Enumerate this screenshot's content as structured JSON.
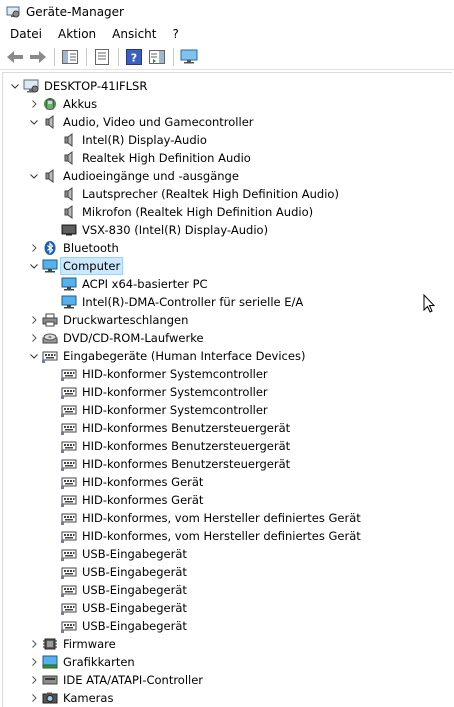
{
  "window": {
    "title": "Geräte-Manager",
    "icon": "device-manager-icon"
  },
  "menu": [
    {
      "id": "datei",
      "label": "Datei"
    },
    {
      "id": "aktion",
      "label": "Aktion"
    },
    {
      "id": "ansicht",
      "label": "Ansicht"
    },
    {
      "id": "help",
      "label": "?"
    }
  ],
  "toolbar": [
    {
      "id": "back",
      "icon": "arrow-left-icon"
    },
    {
      "id": "forward",
      "icon": "arrow-right-icon"
    },
    {
      "id": "sep1",
      "icon": "separator"
    },
    {
      "id": "show-hide",
      "icon": "show-hide-console-tree-icon"
    },
    {
      "id": "sep2",
      "icon": "separator"
    },
    {
      "id": "properties",
      "icon": "properties-icon"
    },
    {
      "id": "sep3",
      "icon": "separator"
    },
    {
      "id": "help",
      "icon": "help-icon"
    },
    {
      "id": "action-pane",
      "icon": "action-pane-icon"
    },
    {
      "id": "sep4",
      "icon": "separator"
    },
    {
      "id": "scan-hardware",
      "icon": "monitor-scan-icon"
    }
  ],
  "tree": [
    {
      "label": "DESKTOP-41IFLSR",
      "level": 0,
      "expander": "expanded",
      "icon": "computer-root-icon"
    },
    {
      "label": "Akkus",
      "level": 1,
      "expander": "collapsed",
      "icon": "battery-icon"
    },
    {
      "label": "Audio, Video und Gamecontroller",
      "level": 1,
      "expander": "expanded",
      "icon": "speaker-icon"
    },
    {
      "label": "Intel(R) Display-Audio",
      "level": 2,
      "expander": "none",
      "icon": "speaker-icon"
    },
    {
      "label": "Realtek High Definition Audio",
      "level": 2,
      "expander": "none",
      "icon": "speaker-icon"
    },
    {
      "label": "Audioeingänge und -ausgänge",
      "level": 1,
      "expander": "expanded",
      "icon": "speaker-icon"
    },
    {
      "label": "Lautsprecher (Realtek High Definition Audio)",
      "level": 2,
      "expander": "none",
      "icon": "speaker-icon"
    },
    {
      "label": "Mikrofon (Realtek High Definition Audio)",
      "level": 2,
      "expander": "none",
      "icon": "speaker-icon"
    },
    {
      "label": "VSX-830 (Intel(R) Display-Audio)",
      "level": 2,
      "expander": "none",
      "icon": "display-audio-icon"
    },
    {
      "label": "Bluetooth",
      "level": 1,
      "expander": "collapsed",
      "icon": "bluetooth-icon"
    },
    {
      "label": "Computer",
      "level": 1,
      "expander": "expanded",
      "icon": "monitor-icon",
      "selected": true
    },
    {
      "label": "ACPI x64-basierter PC",
      "level": 2,
      "expander": "none",
      "icon": "monitor-icon"
    },
    {
      "label": "Intel(R)-DMA-Controller für serielle E/A",
      "level": 2,
      "expander": "none",
      "icon": "monitor-icon"
    },
    {
      "label": "Druckwarteschlangen",
      "level": 1,
      "expander": "collapsed",
      "icon": "printer-icon"
    },
    {
      "label": "DVD/CD-ROM-Laufwerke",
      "level": 1,
      "expander": "collapsed",
      "icon": "disc-drive-icon"
    },
    {
      "label": "Eingabegeräte (Human Interface Devices)",
      "level": 1,
      "expander": "expanded",
      "icon": "hid-icon"
    },
    {
      "label": "HID-konformer Systemcontroller",
      "level": 2,
      "expander": "none",
      "icon": "hid-icon"
    },
    {
      "label": "HID-konformer Systemcontroller",
      "level": 2,
      "expander": "none",
      "icon": "hid-icon"
    },
    {
      "label": "HID-konformer Systemcontroller",
      "level": 2,
      "expander": "none",
      "icon": "hid-icon"
    },
    {
      "label": "HID-konformes Benutzersteuergerät",
      "level": 2,
      "expander": "none",
      "icon": "hid-icon"
    },
    {
      "label": "HID-konformes Benutzersteuergerät",
      "level": 2,
      "expander": "none",
      "icon": "hid-icon"
    },
    {
      "label": "HID-konformes Benutzersteuergerät",
      "level": 2,
      "expander": "none",
      "icon": "hid-icon"
    },
    {
      "label": "HID-konformes Gerät",
      "level": 2,
      "expander": "none",
      "icon": "hid-icon"
    },
    {
      "label": "HID-konformes Gerät",
      "level": 2,
      "expander": "none",
      "icon": "hid-icon"
    },
    {
      "label": "HID-konformes, vom Hersteller definiertes Gerät",
      "level": 2,
      "expander": "none",
      "icon": "hid-icon"
    },
    {
      "label": "HID-konformes, vom Hersteller definiertes Gerät",
      "level": 2,
      "expander": "none",
      "icon": "hid-icon"
    },
    {
      "label": "USB-Eingabegerät",
      "level": 2,
      "expander": "none",
      "icon": "hid-icon"
    },
    {
      "label": "USB-Eingabegerät",
      "level": 2,
      "expander": "none",
      "icon": "hid-icon"
    },
    {
      "label": "USB-Eingabegerät",
      "level": 2,
      "expander": "none",
      "icon": "hid-icon"
    },
    {
      "label": "USB-Eingabegerät",
      "level": 2,
      "expander": "none",
      "icon": "hid-icon"
    },
    {
      "label": "USB-Eingabegerät",
      "level": 2,
      "expander": "none",
      "icon": "hid-icon"
    },
    {
      "label": "Firmware",
      "level": 1,
      "expander": "collapsed",
      "icon": "firmware-icon"
    },
    {
      "label": "Grafikkarten",
      "level": 1,
      "expander": "collapsed",
      "icon": "display-adapter-icon"
    },
    {
      "label": "IDE ATA/ATAPI-Controller",
      "level": 1,
      "expander": "collapsed",
      "icon": "ide-controller-icon"
    },
    {
      "label": "Kameras",
      "level": 1,
      "expander": "collapsed",
      "icon": "camera-icon"
    }
  ]
}
